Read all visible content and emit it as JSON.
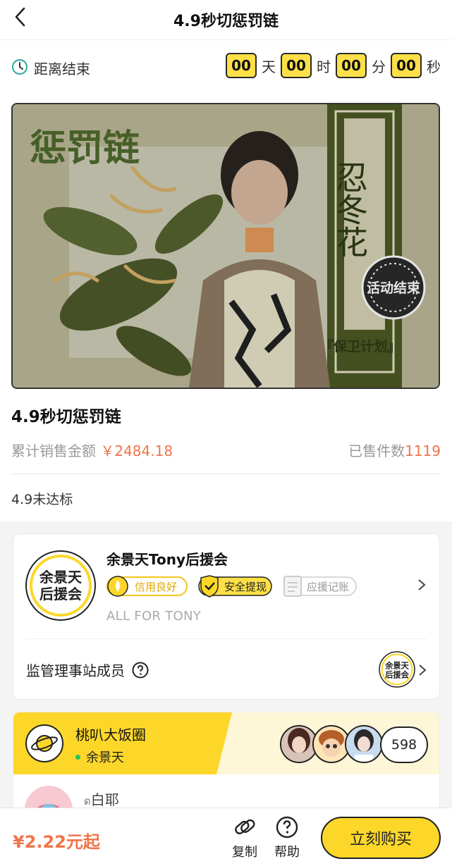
{
  "header": {
    "title": "4.9秒切惩罚链",
    "back_icon": "chevron-left-icon"
  },
  "countdown": {
    "label": "距离结束",
    "days": "00",
    "days_unit": "天",
    "hours": "00",
    "hours_unit": "时",
    "minutes": "00",
    "minutes_unit": "分",
    "seconds": "00",
    "seconds_unit": "秒"
  },
  "banner": {
    "title_art": "惩罚链",
    "side_text": "忍冬花",
    "stamp": "活动结束",
    "plan": "『保卫计划』"
  },
  "product": {
    "title": "4.9秒切惩罚链",
    "sales_label": "累计销售金额",
    "sales_amount": "￥2484.18",
    "sold_label": "已售件数",
    "sold_count": "1119",
    "note": "4.9未达标"
  },
  "club": {
    "name": "余景天Tony后援会",
    "logo_text_1": "余景天",
    "logo_text_2": "后援会",
    "badge_credit": "信用良好",
    "badge_safe": "安全提现",
    "badge_ledger": "应援记账",
    "subtitle": "ALL FOR TONY",
    "supervisor_label": "监管理事站成员"
  },
  "circle": {
    "name": "桃叭大饭圈",
    "member": "余景天",
    "count": "598",
    "post_user": "白耶"
  },
  "bottom": {
    "price": "¥2.22元起",
    "copy_label": "复制",
    "help_label": "帮助",
    "buy_label": "立刻购买"
  },
  "colors": {
    "accent_yellow": "#fcd72a",
    "price_orange": "#f0744a",
    "timer_yellow": "#fde047"
  }
}
